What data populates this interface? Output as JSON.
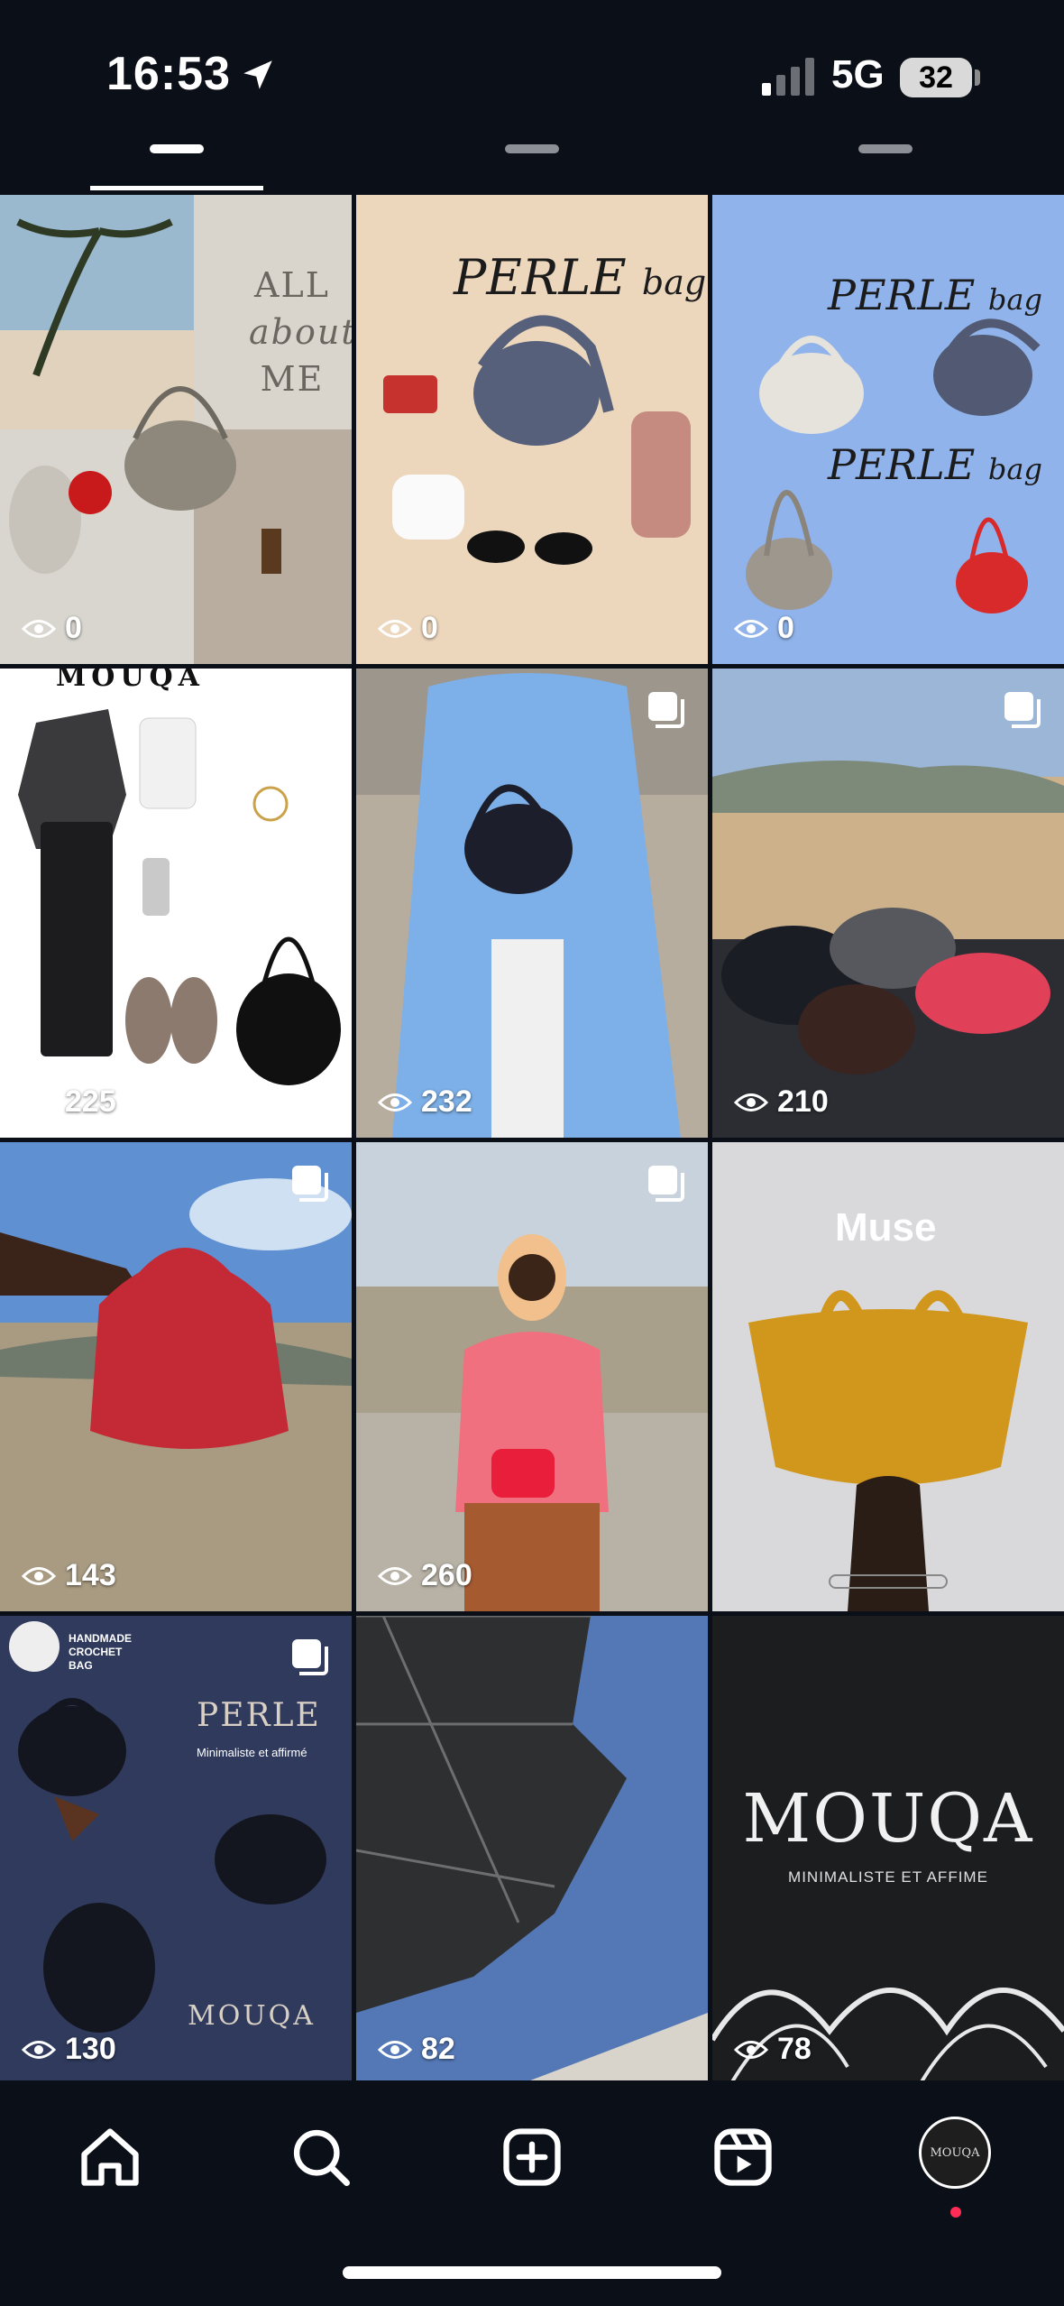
{
  "status_bar": {
    "time": "16:53",
    "network": "5G",
    "battery": "32"
  },
  "tabs": [
    {
      "name": "grid",
      "active": true
    },
    {
      "name": "reels",
      "active": false
    },
    {
      "name": "tagged",
      "active": false
    }
  ],
  "posts": [
    {
      "views": "0",
      "type": "single",
      "text": [
        "ALL",
        "about",
        "ME"
      ]
    },
    {
      "views": "0",
      "type": "single",
      "text": [
        "PERLE",
        "bag"
      ]
    },
    {
      "views": "0",
      "type": "single",
      "text": [
        "PERLE",
        "bag"
      ]
    },
    {
      "views": "225",
      "type": "reel",
      "text": [
        "MOUQA"
      ]
    },
    {
      "views": "232",
      "type": "carousel",
      "text": []
    },
    {
      "views": "210",
      "type": "carousel",
      "text": []
    },
    {
      "views": "143",
      "type": "carousel",
      "text": []
    },
    {
      "views": "260",
      "type": "carousel",
      "text": []
    },
    {
      "views": "",
      "type": "single",
      "text": [
        "Muse"
      ]
    },
    {
      "views": "130",
      "type": "carousel",
      "text": [
        "HANDMADE",
        "CROCHET",
        "BAG",
        "PERLE",
        "Minimaliste et affirmé",
        "MOUQA"
      ]
    },
    {
      "views": "82",
      "type": "single",
      "text": []
    },
    {
      "views": "78",
      "type": "single",
      "text": [
        "MOUQA",
        "MINIMALISTE ET AFFIME"
      ]
    }
  ],
  "nav": {
    "items": [
      "home-icon",
      "search-icon",
      "create-icon",
      "reels-icon",
      "profile-avatar"
    ],
    "avatar_text": "MOUQA"
  },
  "colors": {
    "background": "#0b0f17",
    "accent_dot": "#ff2d55"
  }
}
